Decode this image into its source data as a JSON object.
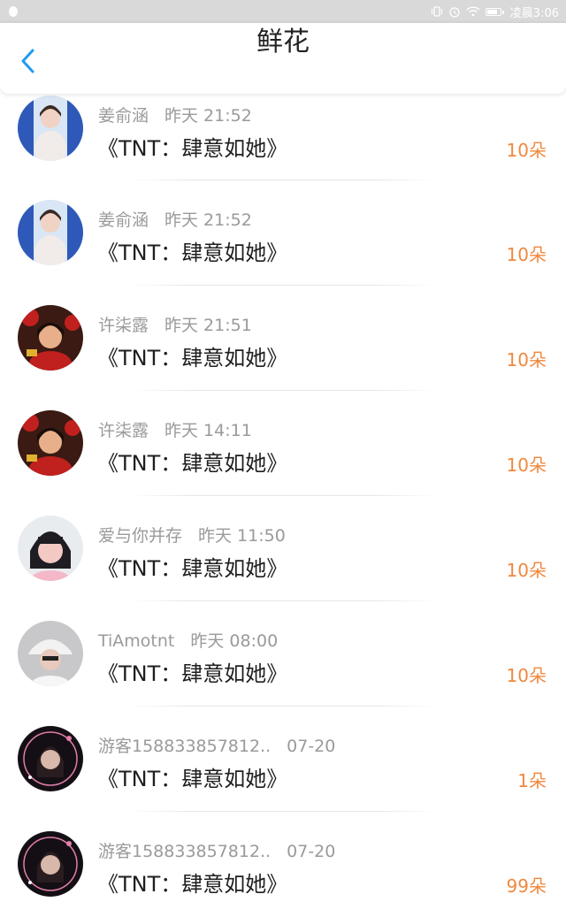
{
  "status_bar": {
    "time": "凌晨3:06"
  },
  "header": {
    "title": "鲜花"
  },
  "items": [
    {
      "name": "姜俞涵",
      "time": "昨天 21:52",
      "book": "《TNT：肆意如她》",
      "count": "10朵",
      "avatar_colors": [
        "#d9e6f5",
        "#2f59b8",
        "#f1ecea"
      ]
    },
    {
      "name": "姜俞涵",
      "time": "昨天 21:52",
      "book": "《TNT：肆意如她》",
      "count": "10朵",
      "avatar_colors": [
        "#d9e6f5",
        "#2f59b8",
        "#f1ecea"
      ]
    },
    {
      "name": "许柒露",
      "time": "昨天 21:51",
      "book": "《TNT：肆意如她》",
      "count": "10朵",
      "avatar_colors": [
        "#3a1a12",
        "#c0201e",
        "#e7b08a"
      ]
    },
    {
      "name": "许柒露",
      "time": "昨天 14:11",
      "book": "《TNT：肆意如她》",
      "count": "10朵",
      "avatar_colors": [
        "#3a1a12",
        "#c0201e",
        "#e7b08a"
      ]
    },
    {
      "name": "爱与你并存",
      "time": "昨天 11:50",
      "book": "《TNT：肆意如她》",
      "count": "10朵",
      "avatar_colors": [
        "#e9ecef",
        "#1e1e22",
        "#f2c9c3"
      ]
    },
    {
      "name": "TiAmotnt",
      "time": "昨天 08:00",
      "book": "《TNT：肆意如她》",
      "count": "10朵",
      "avatar_colors": [
        "#c8c8ca",
        "#f2f2f2",
        "#e8c9bd"
      ]
    },
    {
      "name": "游客158833857812..",
      "time": "07-20",
      "book": "《TNT：肆意如她》",
      "count": "1朵",
      "avatar_colors": [
        "#140f14",
        "#e27fa8",
        "#d8b8aa"
      ]
    },
    {
      "name": "游客158833857812..",
      "time": "07-20",
      "book": "《TNT：肆意如她》",
      "count": "99朵",
      "avatar_colors": [
        "#140f14",
        "#e27fa8",
        "#d8b8aa"
      ]
    }
  ],
  "colors": {
    "accent": "#1e9cf0",
    "count": "#f0883e",
    "meta": "#9a9a9a"
  }
}
